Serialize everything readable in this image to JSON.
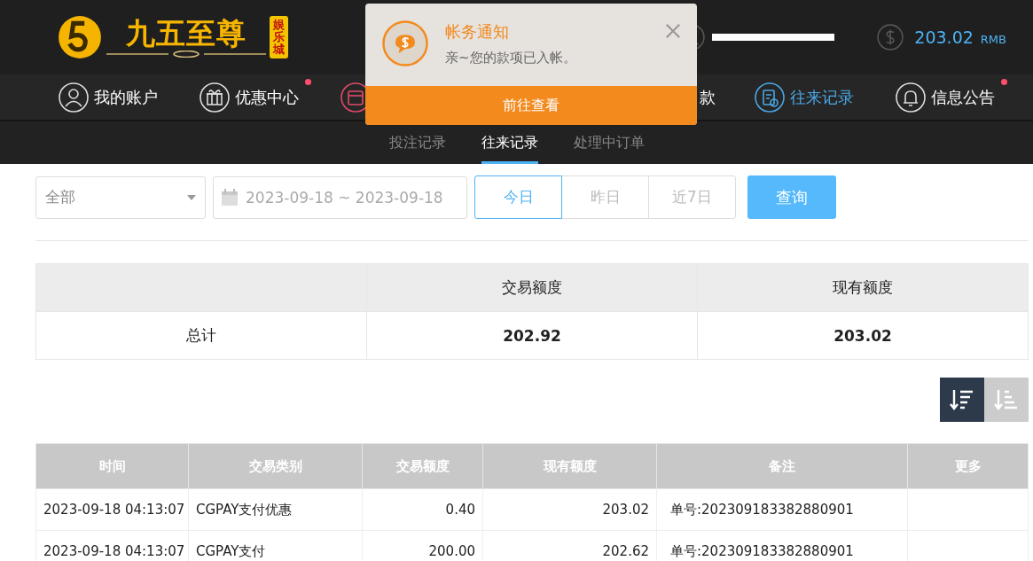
{
  "logo": {
    "name": "九五至尊",
    "badge": "娱乐城"
  },
  "balance": {
    "amount": "203.02",
    "currency": "RMB"
  },
  "nav": [
    {
      "label": "我的账户",
      "kind": "user",
      "selected": false,
      "dot": false
    },
    {
      "label": "优惠中心",
      "kind": "gift",
      "selected": false,
      "dot": true
    },
    {
      "kind": "wallet",
      "selected": false
    },
    {
      "label": "款",
      "kind": "withdraw",
      "selected": false,
      "dot": false
    },
    {
      "label": "往来记录",
      "kind": "record",
      "selected": true,
      "dot": false
    },
    {
      "label": "信息公告",
      "kind": "bell",
      "selected": false,
      "dot": true
    }
  ],
  "subtabs": [
    {
      "label": "投注记录",
      "selected": false
    },
    {
      "label": "往来记录",
      "selected": true
    },
    {
      "label": "处理中订单",
      "selected": false
    }
  ],
  "filter": {
    "type": "全部",
    "date_range": "2023-09-18 ~ 2023-09-18",
    "quick": [
      {
        "label": "今日",
        "selected": true
      },
      {
        "label": "昨日",
        "selected": false
      },
      {
        "label": "近7日",
        "selected": false
      }
    ],
    "query": "查询"
  },
  "summary": {
    "columns": [
      "交易额度",
      "现有额度"
    ],
    "row": {
      "label": "总计",
      "values": [
        "202.92",
        "203.02"
      ]
    }
  },
  "sort": [
    {
      "selected": true
    },
    {
      "selected": false
    }
  ],
  "table": {
    "columns": [
      "时间",
      "交易类别",
      "交易额度",
      "现有额度",
      "备注",
      "更多"
    ],
    "rows": [
      [
        "2023-09-18 04:13:07",
        "CGPAY支付优惠",
        "0.40",
        "203.02",
        "单号:202309183382880901"
      ],
      [
        "2023-09-18 04:13:07",
        "CGPAY支付",
        "200.00",
        "202.62",
        "单号:202309183382880901"
      ]
    ]
  },
  "notification": {
    "title": "帐务通知",
    "message": "亲~您的款项已入帐。",
    "action": "前往查看"
  }
}
